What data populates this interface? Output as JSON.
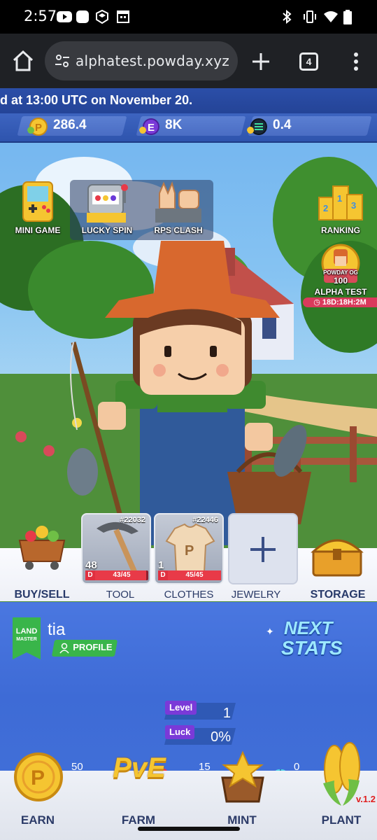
{
  "status_bar": {
    "time": "2:57",
    "left_icons": [
      "youtube-icon",
      "app-icon",
      "shield-icon",
      "calendar-icon"
    ],
    "right_icons": [
      "bluetooth-icon",
      "vibrate-icon",
      "wifi-icon",
      "battery-icon"
    ]
  },
  "browser": {
    "url": "alphatest.powday.xyz",
    "tab_count": "4"
  },
  "game": {
    "announcement": "d at 13:00 UTC on November 20.",
    "currencies": [
      {
        "icon": "p-coin-icon",
        "value": "286.4"
      },
      {
        "icon": "e-token-icon",
        "value": "8K"
      },
      {
        "icon": "gem-icon",
        "value": "0.4"
      }
    ],
    "features": {
      "mini_game": "MINI GAME",
      "lucky_spin": "LUCKY SPIN",
      "rps_clash": "RPS CLASH",
      "ranking": "RANKING",
      "alpha_test": "ALPHA TEST",
      "badge_line1": "POWDAY OG",
      "badge_line2": "100",
      "timer": "18D:18H:2M"
    },
    "shelf": {
      "buy_sell": "BUY/SELL",
      "storage": "STORAGE",
      "slots": [
        {
          "label": "TOOL",
          "id": "#22032",
          "qty": "48",
          "durability": "43/45",
          "durability_fraction": 0.956,
          "tag": "D"
        },
        {
          "label": "CLOTHES",
          "id": "#22446",
          "qty": "1",
          "durability": "45/45",
          "durability_fraction": 1.0,
          "tag": "D"
        },
        {
          "label": "JEWELRY"
        }
      ]
    },
    "profile": {
      "badge_line1": "LAND",
      "badge_line2": "MASTER",
      "name": "tia",
      "profile_button": "PROFILE",
      "level_label": "Level",
      "level_value": "1",
      "luck_label": "Luck",
      "luck_value": "0%",
      "next_stats_line1": "NEXT",
      "next_stats_line2": "STATS",
      "meters": [
        {
          "icon": "lightning-icon",
          "value": "50",
          "max": "100",
          "fraction": 0.5,
          "color": "#f2c230"
        },
        {
          "icon": "heart-icon",
          "value": "15",
          "max": "25",
          "fraction": 0.6,
          "color": "#e8384d"
        },
        {
          "icon": "pill-icon",
          "value": "0",
          "max": "10",
          "fraction": 0.0,
          "color": "#4fd0e8"
        }
      ]
    },
    "nav": {
      "earn": "EARN",
      "farm": "FARM",
      "farm_logo": "PvE",
      "mint": "MINT",
      "plant": "PLANT"
    },
    "version": "v.1.2"
  }
}
